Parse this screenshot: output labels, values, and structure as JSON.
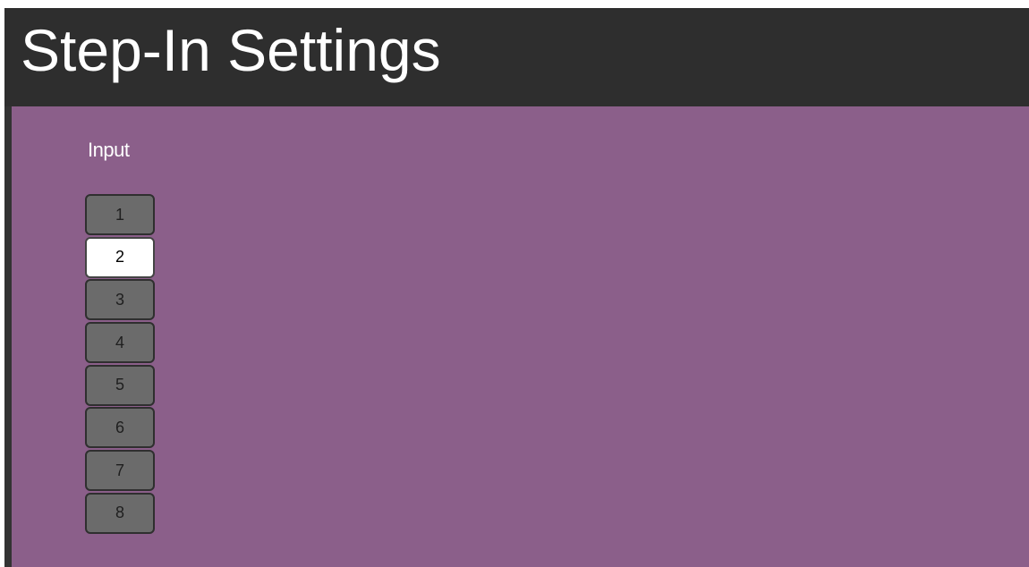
{
  "header": {
    "title": "Step-In Settings"
  },
  "panel": {
    "input_label": "Input",
    "inputs": [
      {
        "label": "1",
        "selected": false
      },
      {
        "label": "2",
        "selected": true
      },
      {
        "label": "3",
        "selected": false
      },
      {
        "label": "4",
        "selected": false
      },
      {
        "label": "5",
        "selected": false
      },
      {
        "label": "6",
        "selected": false
      },
      {
        "label": "7",
        "selected": false
      },
      {
        "label": "8",
        "selected": false
      }
    ]
  },
  "colors": {
    "header_bg": "#2e2e2e",
    "panel_bg": "#8b5f8a",
    "button_bg": "#6b6b6b",
    "button_selected_bg": "#ffffff",
    "text_light": "#ffffff"
  }
}
